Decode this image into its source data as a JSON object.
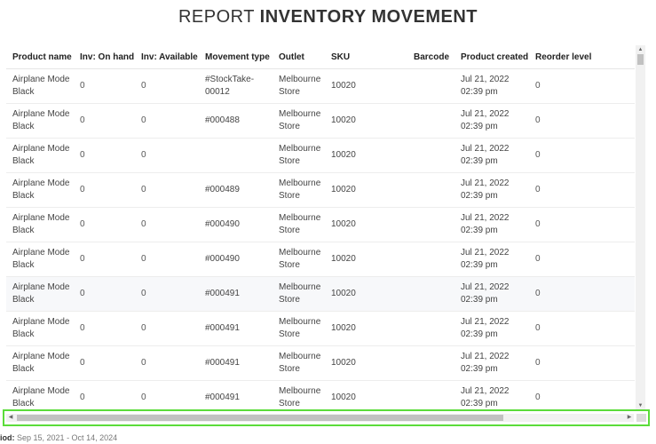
{
  "title": {
    "prefix": "REPORT",
    "main": "INVENTORY MOVEMENT"
  },
  "columns": [
    "Product name",
    "Inv: On hand",
    "Inv: Available",
    "Movement type",
    "Outlet",
    "SKU",
    "Barcode",
    "Product created",
    "Reorder level"
  ],
  "rows": [
    {
      "product": "Airplane Mode Black",
      "on_hand": "0",
      "available": "0",
      "movement": "#StockTake-00012",
      "outlet": "Melbourne Store",
      "sku": "10020",
      "barcode": "",
      "created": "Jul 21, 2022 02:39 pm",
      "reorder": "0"
    },
    {
      "product": "Airplane Mode Black",
      "on_hand": "0",
      "available": "0",
      "movement": "#000488",
      "outlet": "Melbourne Store",
      "sku": "10020",
      "barcode": "",
      "created": "Jul 21, 2022 02:39 pm",
      "reorder": "0"
    },
    {
      "product": "Airplane Mode Black",
      "on_hand": "0",
      "available": "0",
      "movement": "",
      "outlet": "Melbourne Store",
      "sku": "10020",
      "barcode": "",
      "created": "Jul 21, 2022 02:39 pm",
      "reorder": "0"
    },
    {
      "product": "Airplane Mode Black",
      "on_hand": "0",
      "available": "0",
      "movement": "#000489",
      "outlet": "Melbourne Store",
      "sku": "10020",
      "barcode": "",
      "created": "Jul 21, 2022 02:39 pm",
      "reorder": "0"
    },
    {
      "product": "Airplane Mode Black",
      "on_hand": "0",
      "available": "0",
      "movement": "#000490",
      "outlet": "Melbourne Store",
      "sku": "10020",
      "barcode": "",
      "created": "Jul 21, 2022 02:39 pm",
      "reorder": "0"
    },
    {
      "product": "Airplane Mode Black",
      "on_hand": "0",
      "available": "0",
      "movement": "#000490",
      "outlet": "Melbourne Store",
      "sku": "10020",
      "barcode": "",
      "created": "Jul 21, 2022 02:39 pm",
      "reorder": "0"
    },
    {
      "product": "Airplane Mode Black",
      "on_hand": "0",
      "available": "0",
      "movement": "#000491",
      "outlet": "Melbourne Store",
      "sku": "10020",
      "barcode": "",
      "created": "Jul 21, 2022 02:39 pm",
      "reorder": "0"
    },
    {
      "product": "Airplane Mode Black",
      "on_hand": "0",
      "available": "0",
      "movement": "#000491",
      "outlet": "Melbourne Store",
      "sku": "10020",
      "barcode": "",
      "created": "Jul 21, 2022 02:39 pm",
      "reorder": "0"
    },
    {
      "product": "Airplane Mode Black",
      "on_hand": "0",
      "available": "0",
      "movement": "#000491",
      "outlet": "Melbourne Store",
      "sku": "10020",
      "barcode": "",
      "created": "Jul 21, 2022 02:39 pm",
      "reorder": "0"
    },
    {
      "product": "Airplane Mode Black",
      "on_hand": "0",
      "available": "0",
      "movement": "#000491",
      "outlet": "Melbourne Store",
      "sku": "10020",
      "barcode": "",
      "created": "Jul 21, 2022 02:39 pm",
      "reorder": "0"
    }
  ],
  "footer": {
    "period_label": "iod:",
    "period_value": "Sep 15, 2021 - Oct 14, 2024"
  },
  "icons": {
    "scroll_left": "chevron-left-icon",
    "scroll_right": "chevron-right-icon",
    "scroll_up": "chevron-up-icon",
    "scroll_down": "chevron-down-icon"
  },
  "colors": {
    "highlight": "#5bdc3a",
    "alt_row": "#f7f8fa"
  }
}
